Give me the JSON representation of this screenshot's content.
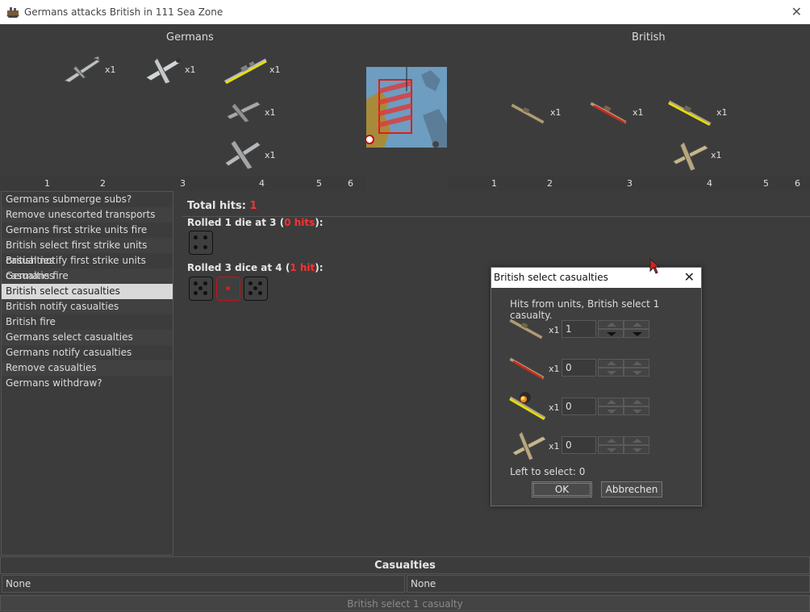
{
  "window": {
    "title": "Germans attacks British in 111 Sea Zone"
  },
  "battle": {
    "attacker_label": "Germans",
    "defender_label": "British",
    "attacker_units": [
      {
        "icon": "bomber-plane-icon",
        "count": "x1"
      },
      {
        "icon": "fighter-plane-icon",
        "count": "x1"
      },
      {
        "icon": "battleship-icon",
        "count": "x1"
      },
      {
        "icon": "tactical-bomber-icon",
        "count": "x1"
      },
      {
        "icon": "heavy-bomber-icon",
        "count": "x1"
      }
    ],
    "defender_units": [
      {
        "icon": "cruiser-icon",
        "count": "x1"
      },
      {
        "icon": "damaged-destroyer-icon",
        "count": "x1"
      },
      {
        "icon": "battleship-icon",
        "count": "x1"
      },
      {
        "icon": "fighter-plane-icon",
        "count": "x1"
      }
    ],
    "attacker_ruler": [
      "1",
      "2",
      "3",
      "4",
      "5",
      "6"
    ],
    "defender_ruler": [
      "1",
      "2",
      "3",
      "4",
      "5",
      "6"
    ]
  },
  "steps": [
    "Germans submerge subs?",
    "Remove unescorted transports",
    "Germans first strike units fire",
    "British select first strike units casualties",
    "British notify first strike units casualties",
    "Germans fire",
    "British select casualties",
    "British notify casualties",
    "British fire",
    "Germans select casualties",
    "Germans notify casualties",
    "Remove casualties",
    "Germans withdraw?"
  ],
  "selected_step": "British select casualties",
  "dice": {
    "total_label": "Total hits: ",
    "total_value": "1",
    "roll1_prefix": "Rolled 1 die at 3 (",
    "roll1_hits": "0 hits",
    "roll1_suffix": "):",
    "roll2_prefix": "Rolled 3 dice at 4 (",
    "roll2_hits": "1 hit",
    "roll2_suffix": "):",
    "roll1_dice": [
      4
    ],
    "roll2_dice": [
      5,
      1,
      5
    ]
  },
  "casualties": {
    "header": "Casualties",
    "left": "None",
    "right": "None"
  },
  "status": "British select 1 casualty",
  "dialog": {
    "title": "British select casualties",
    "message": "Hits from units,  British select 1 casualty.",
    "rows": [
      {
        "icon": "cruiser-icon",
        "count": "x1",
        "value": "1"
      },
      {
        "icon": "damaged-destroyer-icon",
        "count": "x1",
        "value": "0"
      },
      {
        "icon": "burning-battleship-icon",
        "count": "x1",
        "value": "0"
      },
      {
        "icon": "fighter-plane-icon",
        "count": "x1",
        "value": "0"
      }
    ],
    "left_to_select": "Left to select: 0",
    "ok": "OK",
    "cancel": "Abbrechen"
  }
}
